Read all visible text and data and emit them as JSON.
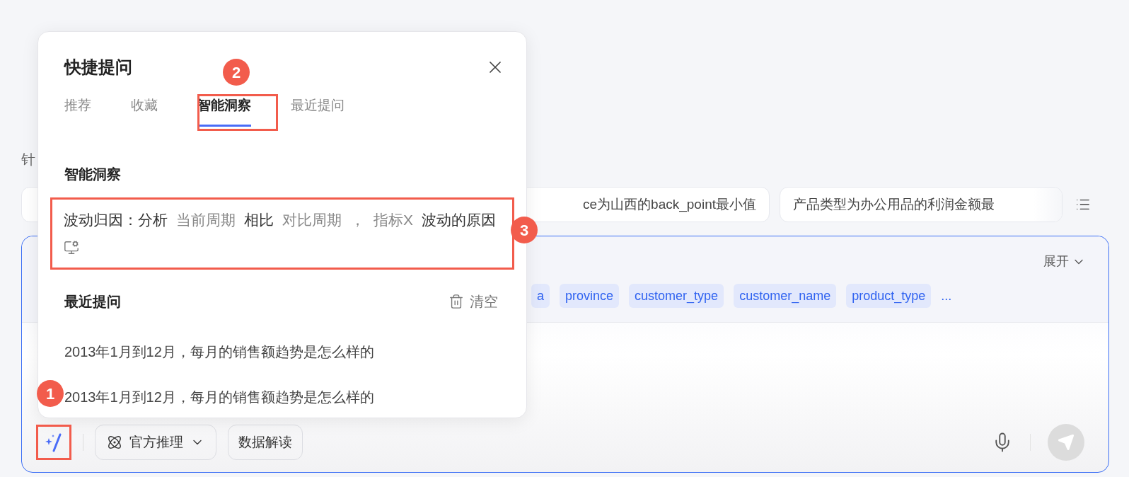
{
  "background": {
    "hint_fragment": "针",
    "suggestions": [
      "ce为山西的back_point最小值",
      "产品类型为办公用品的利润金额最"
    ],
    "input": {
      "expand_label": "展开",
      "fields": [
        "a",
        "province",
        "customer_type",
        "customer_name",
        "product_type"
      ],
      "more": "...",
      "mode_button": "官方推理",
      "interpret_button": "数据解读"
    }
  },
  "popup": {
    "title": "快捷提问",
    "tabs": [
      {
        "label": "推荐",
        "selected": false
      },
      {
        "label": "收藏",
        "selected": false
      },
      {
        "label": "智能洞察",
        "selected": true
      },
      {
        "label": "最近提问",
        "selected": false
      }
    ],
    "insight": {
      "heading": "智能洞察",
      "segments": [
        {
          "kind": "text",
          "text": "波动归因：分析"
        },
        {
          "kind": "variable",
          "text": "当前周期"
        },
        {
          "kind": "text",
          "text": "相比"
        },
        {
          "kind": "variable",
          "text": "对比周期"
        },
        {
          "kind": "variable",
          "text": "，"
        },
        {
          "kind": "variable",
          "text": "指标X"
        },
        {
          "kind": "text",
          "text": "波动的原因"
        }
      ]
    },
    "recent": {
      "heading": "最近提问",
      "clear_label": "清空",
      "items": [
        "2013年1月到12月，每月的销售额趋势是怎么样的",
        "2013年1月到12月，每月的销售额趋势是怎么样的"
      ]
    }
  },
  "annotations": [
    "1",
    "2",
    "3"
  ]
}
